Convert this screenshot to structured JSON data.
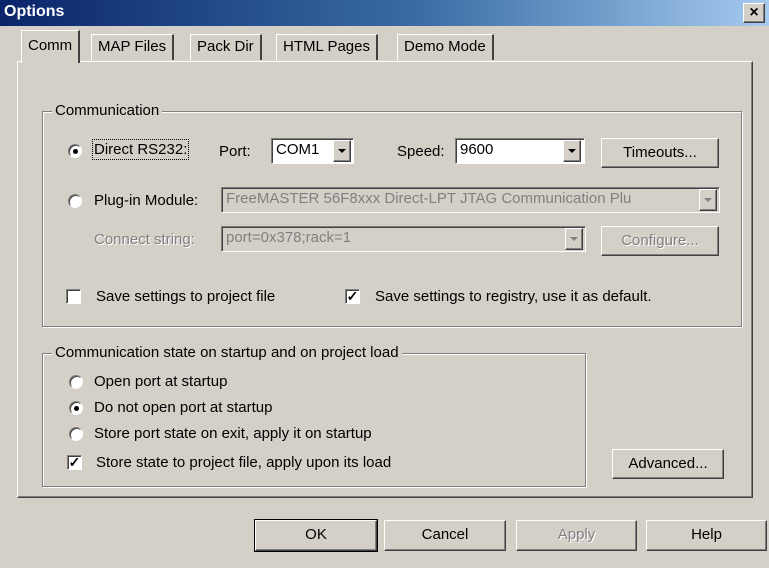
{
  "window": {
    "title": "Options",
    "close": "×"
  },
  "tabs": [
    {
      "label": "Comm",
      "active": true
    },
    {
      "label": "MAP Files"
    },
    {
      "label": "Pack Dir"
    },
    {
      "label": "HTML Pages"
    },
    {
      "label": "Demo Mode"
    }
  ],
  "communication": {
    "group_title": "Communication",
    "direct_rs232": {
      "label": "Direct RS232:",
      "checked": true
    },
    "port_label": "Port:",
    "port_value": "COM1",
    "speed_label": "Speed:",
    "speed_value": "9600",
    "timeouts_button": "Timeouts...",
    "plugin_module": {
      "label": "Plug-in Module:",
      "checked": false
    },
    "plugin_value": "FreeMASTER 56F8xxx Direct-LPT JTAG Communication Plu",
    "connect_label": "Connect string:",
    "connect_value": "port=0x378;rack=1",
    "configure_button": "Configure...",
    "save_project": {
      "label": "Save settings to project file",
      "checked": false
    },
    "save_registry": {
      "label": "Save settings to registry, use it as default.",
      "checked": true
    }
  },
  "startup": {
    "group_title": "Communication state on startup and on project load",
    "options": [
      {
        "label": "Open port at startup",
        "checked": false
      },
      {
        "label": "Do not open port at startup",
        "checked": true
      },
      {
        "label": "Store port state on exit, apply it on startup",
        "checked": false
      }
    ],
    "store_state": {
      "label": "Store state to project file, apply upon its load",
      "checked": true
    },
    "advanced_button": "Advanced..."
  },
  "footer": {
    "ok": "OK",
    "cancel": "Cancel",
    "apply": "Apply",
    "help": "Help"
  }
}
